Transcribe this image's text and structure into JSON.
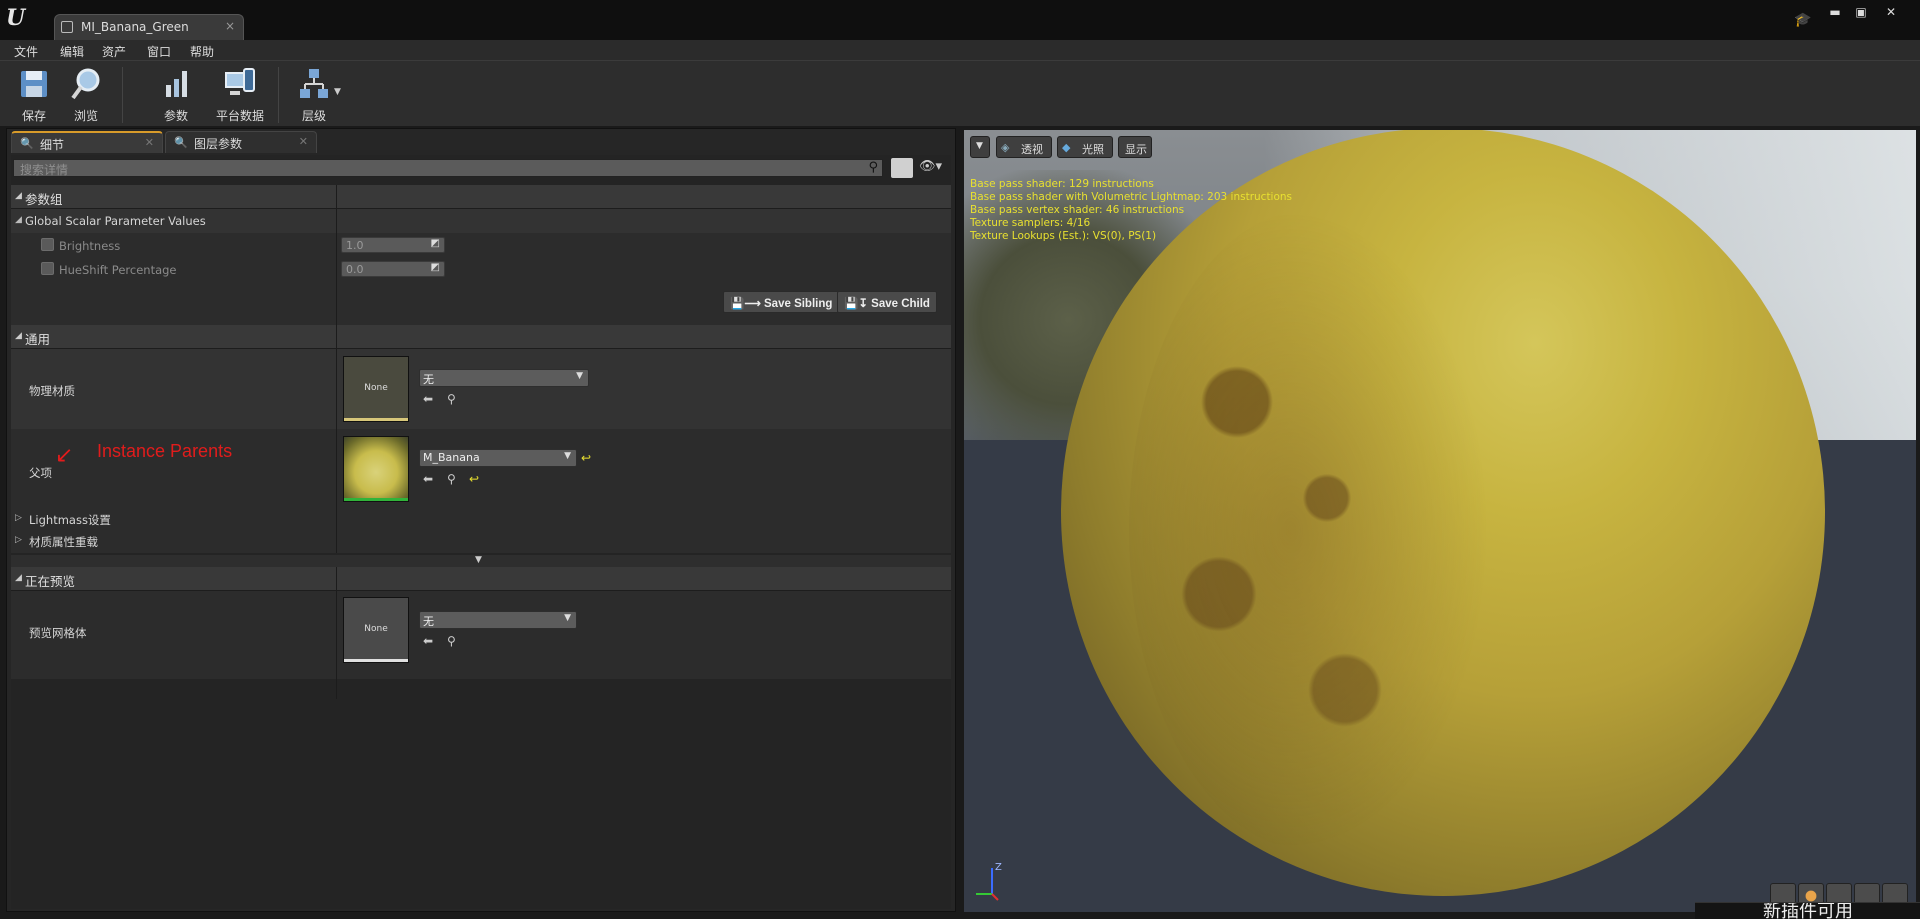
{
  "window": {
    "tab_title": "MI_Banana_Green",
    "tab_close": "×",
    "controls": {
      "minimize": "▬",
      "maximize": "▣",
      "close": "✕"
    }
  },
  "menu": [
    "文件",
    "编辑",
    "资产",
    "窗口",
    "帮助"
  ],
  "toolbar": {
    "save": "保存",
    "browse": "浏览",
    "params": "参数",
    "platform": "平台数据",
    "hierarchy": "层级"
  },
  "panels": {
    "details_tab": "细节",
    "layer_params_tab": "图层参数"
  },
  "details": {
    "search_placeholder": "搜索详情",
    "param_group_title": "参数组",
    "global_scalar_title": "Global Scalar Parameter Values",
    "params": [
      {
        "name": "Brightness",
        "value": "1.0"
      },
      {
        "name": "HueShift Percentage",
        "value": "0.0"
      }
    ],
    "save_sibling": "Save Sibling",
    "save_child": "Save Child",
    "general_title": "通用",
    "phys_material_label": "物理材质",
    "phys_material_thumb": "None",
    "phys_material_value": "无",
    "parent_label": "父项",
    "parent_value": "M_Banana",
    "annotation": "Instance Parents",
    "lightmass": "Lightmass设置",
    "material_override": "材质属性重载",
    "previewing_title": "正在预览",
    "preview_mesh_label": "预览网格体",
    "preview_mesh_thumb": "None",
    "preview_mesh_value": "无"
  },
  "viewport": {
    "perspective": "透视",
    "lit": "光照",
    "show": "显示",
    "stats": [
      "Base pass shader: 129 instructions",
      "Base pass shader with Volumetric Lightmap: 203 instructions",
      "Base pass vertex shader: 46 instructions",
      "Texture samplers: 4/16",
      "Texture Lookups (Est.): VS(0), PS(1)"
    ],
    "axis_z": "Z"
  },
  "notification": "新插件可用",
  "colors": {
    "accent": "#d89b2a",
    "stats_text": "#e8e030",
    "annotation": "#e11c1c",
    "phys_bar": "#d7c77a",
    "parent_bar": "#31b33a"
  }
}
